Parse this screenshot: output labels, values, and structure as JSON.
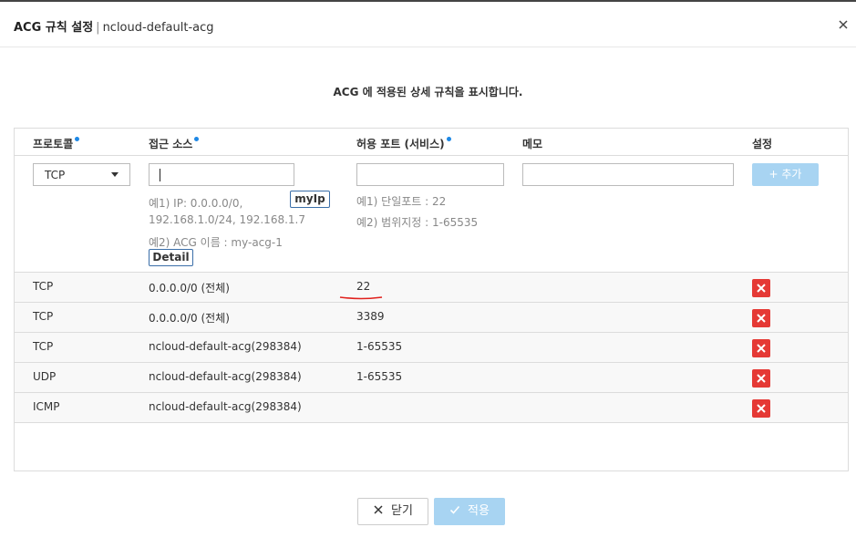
{
  "modal": {
    "title_main": "ACG 규칙 설정",
    "title_sep": "|",
    "title_sub": "ncloud-default-acg",
    "description": "ACG 에 적용된 상세 규칙을 표시합니다."
  },
  "table": {
    "headers": {
      "protocol": "프로토콜",
      "source": "접근 소스",
      "port": "허용 포트 (서비스)",
      "memo": "메모",
      "settings": "설정"
    },
    "form": {
      "protocol_selected": "TCP",
      "source_value": "",
      "port_value": "",
      "memo_value": "",
      "myip_label": "myIp",
      "detail_label": "Detail",
      "add_label": "+ 추가",
      "source_hint_1a": "예1) IP: 0.0.0.0/0,",
      "source_hint_1b": "192.168.1.0/24, 192.168.1.7",
      "source_hint_2": "예2) ACG 이름 : my-acg-1",
      "port_hint_1": "예1) 단일포트 : 22",
      "port_hint_2": "예2) 범위지정 : 1-65535"
    },
    "rows": [
      {
        "protocol": "TCP",
        "source": "0.0.0.0/0 (전체)",
        "port": "22"
      },
      {
        "protocol": "TCP",
        "source": "0.0.0.0/0 (전체)",
        "port": "3389"
      },
      {
        "protocol": "TCP",
        "source": "ncloud-default-acg(298384)",
        "port": "1-65535"
      },
      {
        "protocol": "UDP",
        "source": "ncloud-default-acg(298384)",
        "port": "1-65535"
      },
      {
        "protocol": "ICMP",
        "source": "ncloud-default-acg(298384)",
        "port": ""
      }
    ]
  },
  "footer": {
    "close_label": "닫기",
    "apply_label": "적용"
  },
  "colors": {
    "accent_blue": "#1e88e5",
    "disabled_blue": "#a8d4f2",
    "delete_red": "#e53935",
    "annotation_red": "#e0201c"
  },
  "icons": {
    "close": "close-icon",
    "delete": "delete-x-icon",
    "dropdown": "chevron-down-icon",
    "check": "check-icon"
  }
}
